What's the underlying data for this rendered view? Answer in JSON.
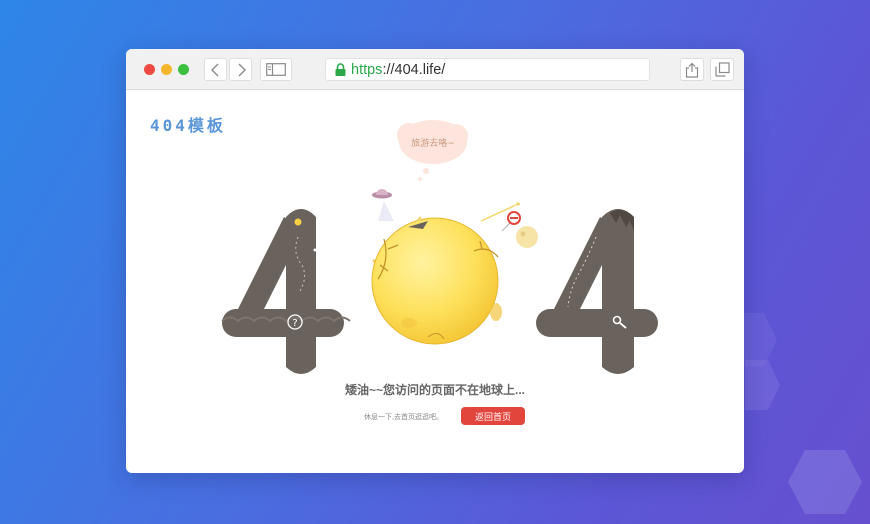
{
  "browser": {
    "url_protocol": "https",
    "url_rest": "://404.life/"
  },
  "page": {
    "brand": "404模板",
    "bubble_text": "旅游去咯~",
    "message": "矮油~~您访问的页面不在地球上...",
    "sub_text": "休息一下,去首页逛逛吧。",
    "home_button": "返回首页"
  },
  "colors": {
    "page_gradient_start": "#2e86e8",
    "page_gradient_end": "#6650cf",
    "digit": "#6a625c",
    "moon": "#fde05a",
    "button": "#e2453c",
    "brand": "#5a96d8",
    "secure": "#2aa84a"
  },
  "icons": {
    "back": "chevron-left-icon",
    "forward": "chevron-right-icon",
    "sidebar": "sidebar-icon",
    "lock": "lock-icon",
    "share": "share-icon",
    "tabs": "tabs-icon",
    "question": "question-icon",
    "search": "search-icon"
  }
}
